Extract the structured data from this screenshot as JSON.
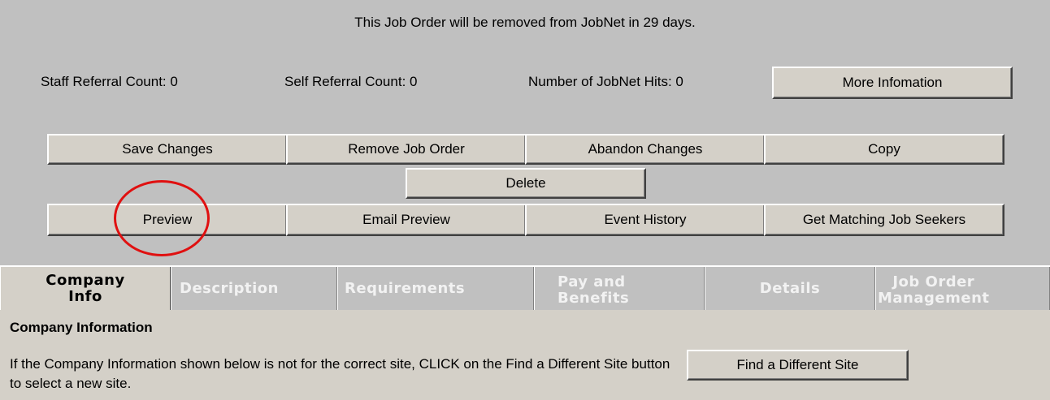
{
  "notice": "This Job Order will be removed from JobNet in 29 days.",
  "stats": {
    "staff_referral": "Staff Referral Count: 0",
    "self_referral": "Self Referral Count: 0",
    "jobnet_hits": "Number of JobNet Hits: 0"
  },
  "buttons": {
    "more_info": "More Infomation",
    "save_changes": "Save Changes",
    "remove_job_order": "Remove Job Order",
    "abandon_changes": "Abandon Changes",
    "copy": "Copy",
    "delete": "Delete",
    "preview": "Preview",
    "email_preview": "Email Preview",
    "event_history": "Event History",
    "get_matching": "Get Matching Job Seekers",
    "find_different_site": "Find a Different Site"
  },
  "tabs": {
    "company_info_1": "Company",
    "company_info_2": "Info",
    "description": "Description",
    "requirements": "Requirements",
    "pay_1": "Pay and",
    "pay_2": "Benefits",
    "details": "Details",
    "jom_1": "Job Order",
    "jom_2": "Management"
  },
  "content": {
    "heading": "Company Information",
    "info": "If the Company Information shown below is not for the correct site, CLICK on the Find a Different Site button to select a new site."
  },
  "colors": {
    "panel": "#c0c0c0",
    "button_face": "#d4d0c8",
    "annotation": "#e01010"
  }
}
